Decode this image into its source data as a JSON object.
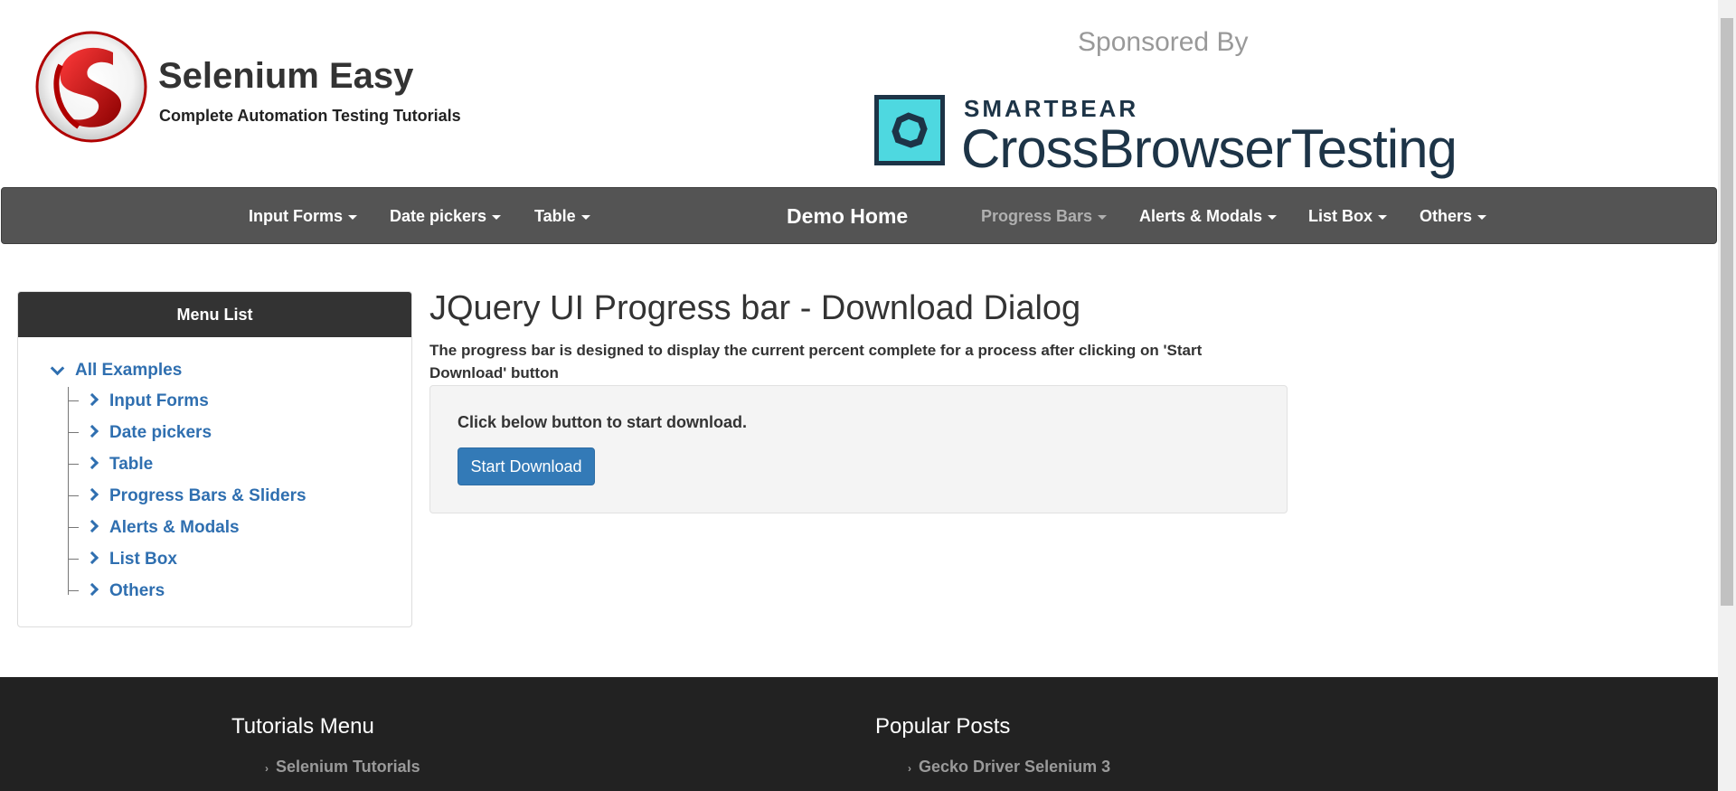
{
  "header": {
    "brand_title": "Selenium Easy",
    "brand_subtitle": "Complete Automation Testing Tutorials",
    "logo_icon": "selenium-easy-s-logo",
    "sponsored_label": "Sponsored By",
    "sponsor_company": "SMARTBEAR",
    "sponsor_product": "CrossBrowserTesting"
  },
  "navbar": {
    "items": [
      {
        "label": "Input Forms"
      },
      {
        "label": "Date pickers"
      },
      {
        "label": "Table"
      },
      {
        "label": "Demo Home"
      },
      {
        "label": "Progress Bars"
      },
      {
        "label": "Alerts & Modals"
      },
      {
        "label": "List Box"
      },
      {
        "label": "Others"
      }
    ]
  },
  "sidebar": {
    "title": "Menu List",
    "root_label": "All Examples",
    "items": [
      {
        "label": "Input Forms"
      },
      {
        "label": "Date pickers"
      },
      {
        "label": "Table"
      },
      {
        "label": "Progress Bars & Sliders"
      },
      {
        "label": "Alerts & Modals"
      },
      {
        "label": "List Box"
      },
      {
        "label": "Others"
      }
    ]
  },
  "main": {
    "title": "JQuery UI Progress bar - Download Dialog",
    "description": "The progress bar is designed to display the current percent complete for a process after clicking on 'Start Download' button",
    "panel_text": "Click below button to start download.",
    "button_label": "Start Download"
  },
  "footer": {
    "tutorials_heading": "Tutorials Menu",
    "tutorials_link": "Selenium Tutorials",
    "popular_heading": "Popular Posts",
    "popular_link": "Gecko Driver Selenium 3"
  },
  "colors": {
    "navbar_bg": "#545454",
    "link": "#2f6fb0",
    "primary_button": "#337ab7",
    "footer_bg": "#222222",
    "logo_red": "#d51d1d",
    "sponsor_teal": "#4ed8e0"
  }
}
